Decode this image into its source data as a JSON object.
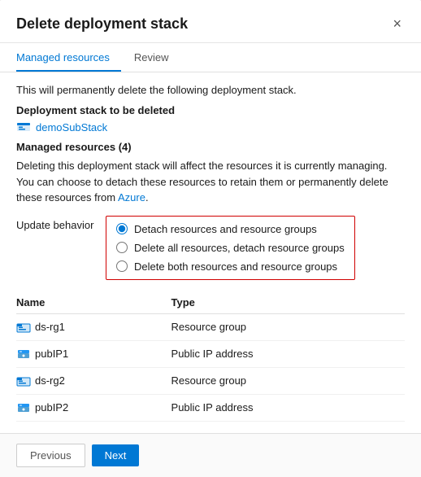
{
  "dialog": {
    "title": "Delete deployment stack",
    "close_label": "×"
  },
  "tabs": [
    {
      "id": "managed-resources",
      "label": "Managed resources",
      "active": true
    },
    {
      "id": "review",
      "label": "Review",
      "active": false
    }
  ],
  "body": {
    "info_text": "This will permanently delete the following deployment stack.",
    "deployment_stack_label": "Deployment stack to be deleted",
    "stack_name": "demoSubStack",
    "managed_resources_label": "Managed resources (4)",
    "description": "Deleting this deployment stack will affect the resources it is currently managing. You can choose to detach these resources to retain them or permanently delete these resources from Azure.",
    "description_link": "Azure",
    "update_behavior_label": "Update behavior",
    "radio_options": [
      {
        "id": "detach",
        "label": "Detach resources and resource groups",
        "checked": true
      },
      {
        "id": "delete-resources",
        "label": "Delete all resources, detach resource groups",
        "checked": false
      },
      {
        "id": "delete-both",
        "label": "Delete both resources and resource groups",
        "checked": false
      }
    ],
    "table": {
      "columns": [
        "Name",
        "Type"
      ],
      "rows": [
        {
          "name": "ds-rg1",
          "type": "Resource group",
          "icon": "resource-group"
        },
        {
          "name": "pubIP1",
          "type": "Public IP address",
          "icon": "public-ip"
        },
        {
          "name": "ds-rg2",
          "type": "Resource group",
          "icon": "resource-group"
        },
        {
          "name": "pubIP2",
          "type": "Public IP address",
          "icon": "public-ip"
        }
      ]
    }
  },
  "footer": {
    "previous_label": "Previous",
    "next_label": "Next"
  },
  "colors": {
    "accent": "#0078d4",
    "radio_border": "#d00000"
  }
}
